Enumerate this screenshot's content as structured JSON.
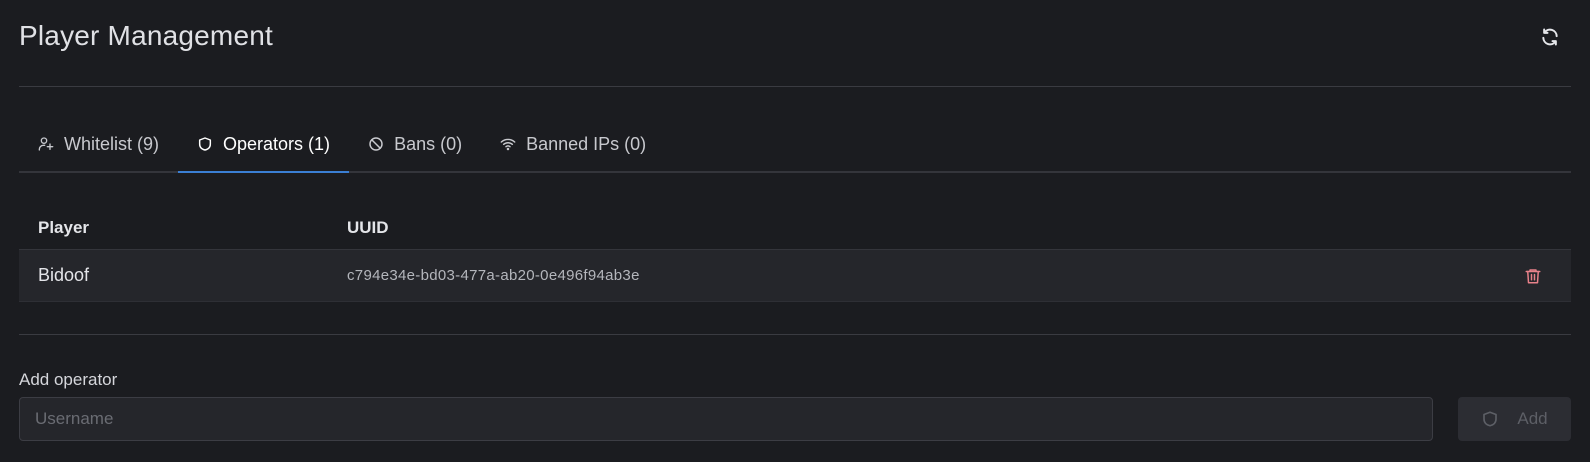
{
  "header": {
    "title": "Player Management",
    "refresh_icon": "refresh-icon"
  },
  "tabs": [
    {
      "label": "Whitelist (9)",
      "icon": "user-plus-icon",
      "active": false
    },
    {
      "label": "Operators (1)",
      "icon": "shield-icon",
      "active": true
    },
    {
      "label": "Bans (0)",
      "icon": "ban-icon",
      "active": false
    },
    {
      "label": "Banned IPs (0)",
      "icon": "wifi-icon",
      "active": false
    }
  ],
  "table": {
    "columns": [
      "Player",
      "UUID"
    ],
    "rows": [
      {
        "player": "Bidoof",
        "uuid": "c794e34e-bd03-477a-ab20-0e496f94ab3e",
        "action_icon": "trash-icon"
      }
    ]
  },
  "add_form": {
    "label": "Add operator",
    "placeholder": "Username",
    "value": "",
    "button_label": "Add",
    "button_icon": "shield-icon",
    "button_disabled": true
  },
  "colors": {
    "background": "#1b1c20",
    "accent": "#3b7fd4",
    "danger": "#e8818a"
  }
}
